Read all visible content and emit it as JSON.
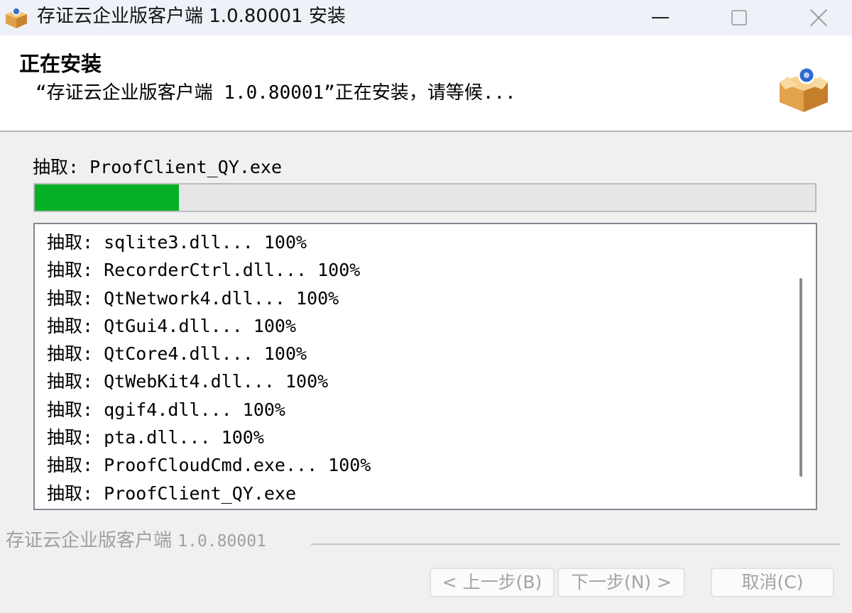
{
  "window": {
    "title": "存证云企业版客户端 1.0.80001 安装"
  },
  "header": {
    "title": "正在安装",
    "subtitle": "“存证云企业版客户端 1.0.80001”正在安装，请等候..."
  },
  "status": {
    "current_label": "抽取: ProofClient_QY.exe",
    "progress_fraction": 0.185
  },
  "log": {
    "items": [
      "抽取: sqlite3.dll... 100%",
      "抽取: RecorderCtrl.dll... 100%",
      "抽取: QtNetwork4.dll... 100%",
      "抽取: QtGui4.dll... 100%",
      "抽取: QtCore4.dll... 100%",
      "抽取: QtWebKit4.dll... 100%",
      "抽取: qgif4.dll... 100%",
      "抽取: pta.dll... 100%",
      "抽取: ProofCloudCmd.exe... 100%",
      "抽取: ProofClient_QY.exe"
    ]
  },
  "footer": {
    "brand_name": "存证云企业版客户端",
    "brand_version": "1.0.80001",
    "back_label": "< 上一步(B)",
    "next_label": "下一步(N) >",
    "cancel_label": "取消(C)"
  },
  "colors": {
    "progress": "#06b025",
    "header_bg": "#ffffff",
    "window_bg": "#f0f0f0"
  },
  "icons": {
    "app": "installer-box-icon",
    "header": "installer-box-icon"
  }
}
